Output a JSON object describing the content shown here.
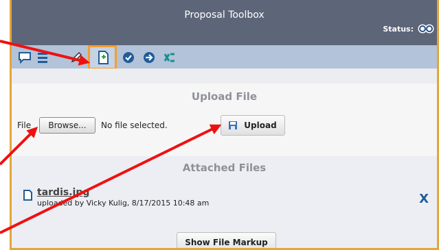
{
  "header": {
    "title": "Proposal Toolbox",
    "status_label": "Status:"
  },
  "toolbar": {
    "icons": [
      "comment-icon",
      "list-icon",
      "edit-icon",
      "add-document-icon",
      "check-icon",
      "arrow-right-icon",
      "shuffle-icon"
    ],
    "active_icon": "add-document-icon"
  },
  "upload": {
    "heading": "Upload File",
    "file_label": "File",
    "browse_label": "Browse...",
    "no_file_text": "No file selected.",
    "upload_label": "Upload"
  },
  "attached": {
    "heading": "Attached Files",
    "files": [
      {
        "name": "tardis.jpg",
        "meta": "uploaded by Vicky Kulig, 8/17/2015 10:48 am"
      }
    ],
    "markup_button": "Show File Markup"
  },
  "colors": {
    "header": "#5d6579",
    "toolbar": "#b3c3d9",
    "highlight": "#f39e2e",
    "annotation_arrow": "#ee1111"
  }
}
